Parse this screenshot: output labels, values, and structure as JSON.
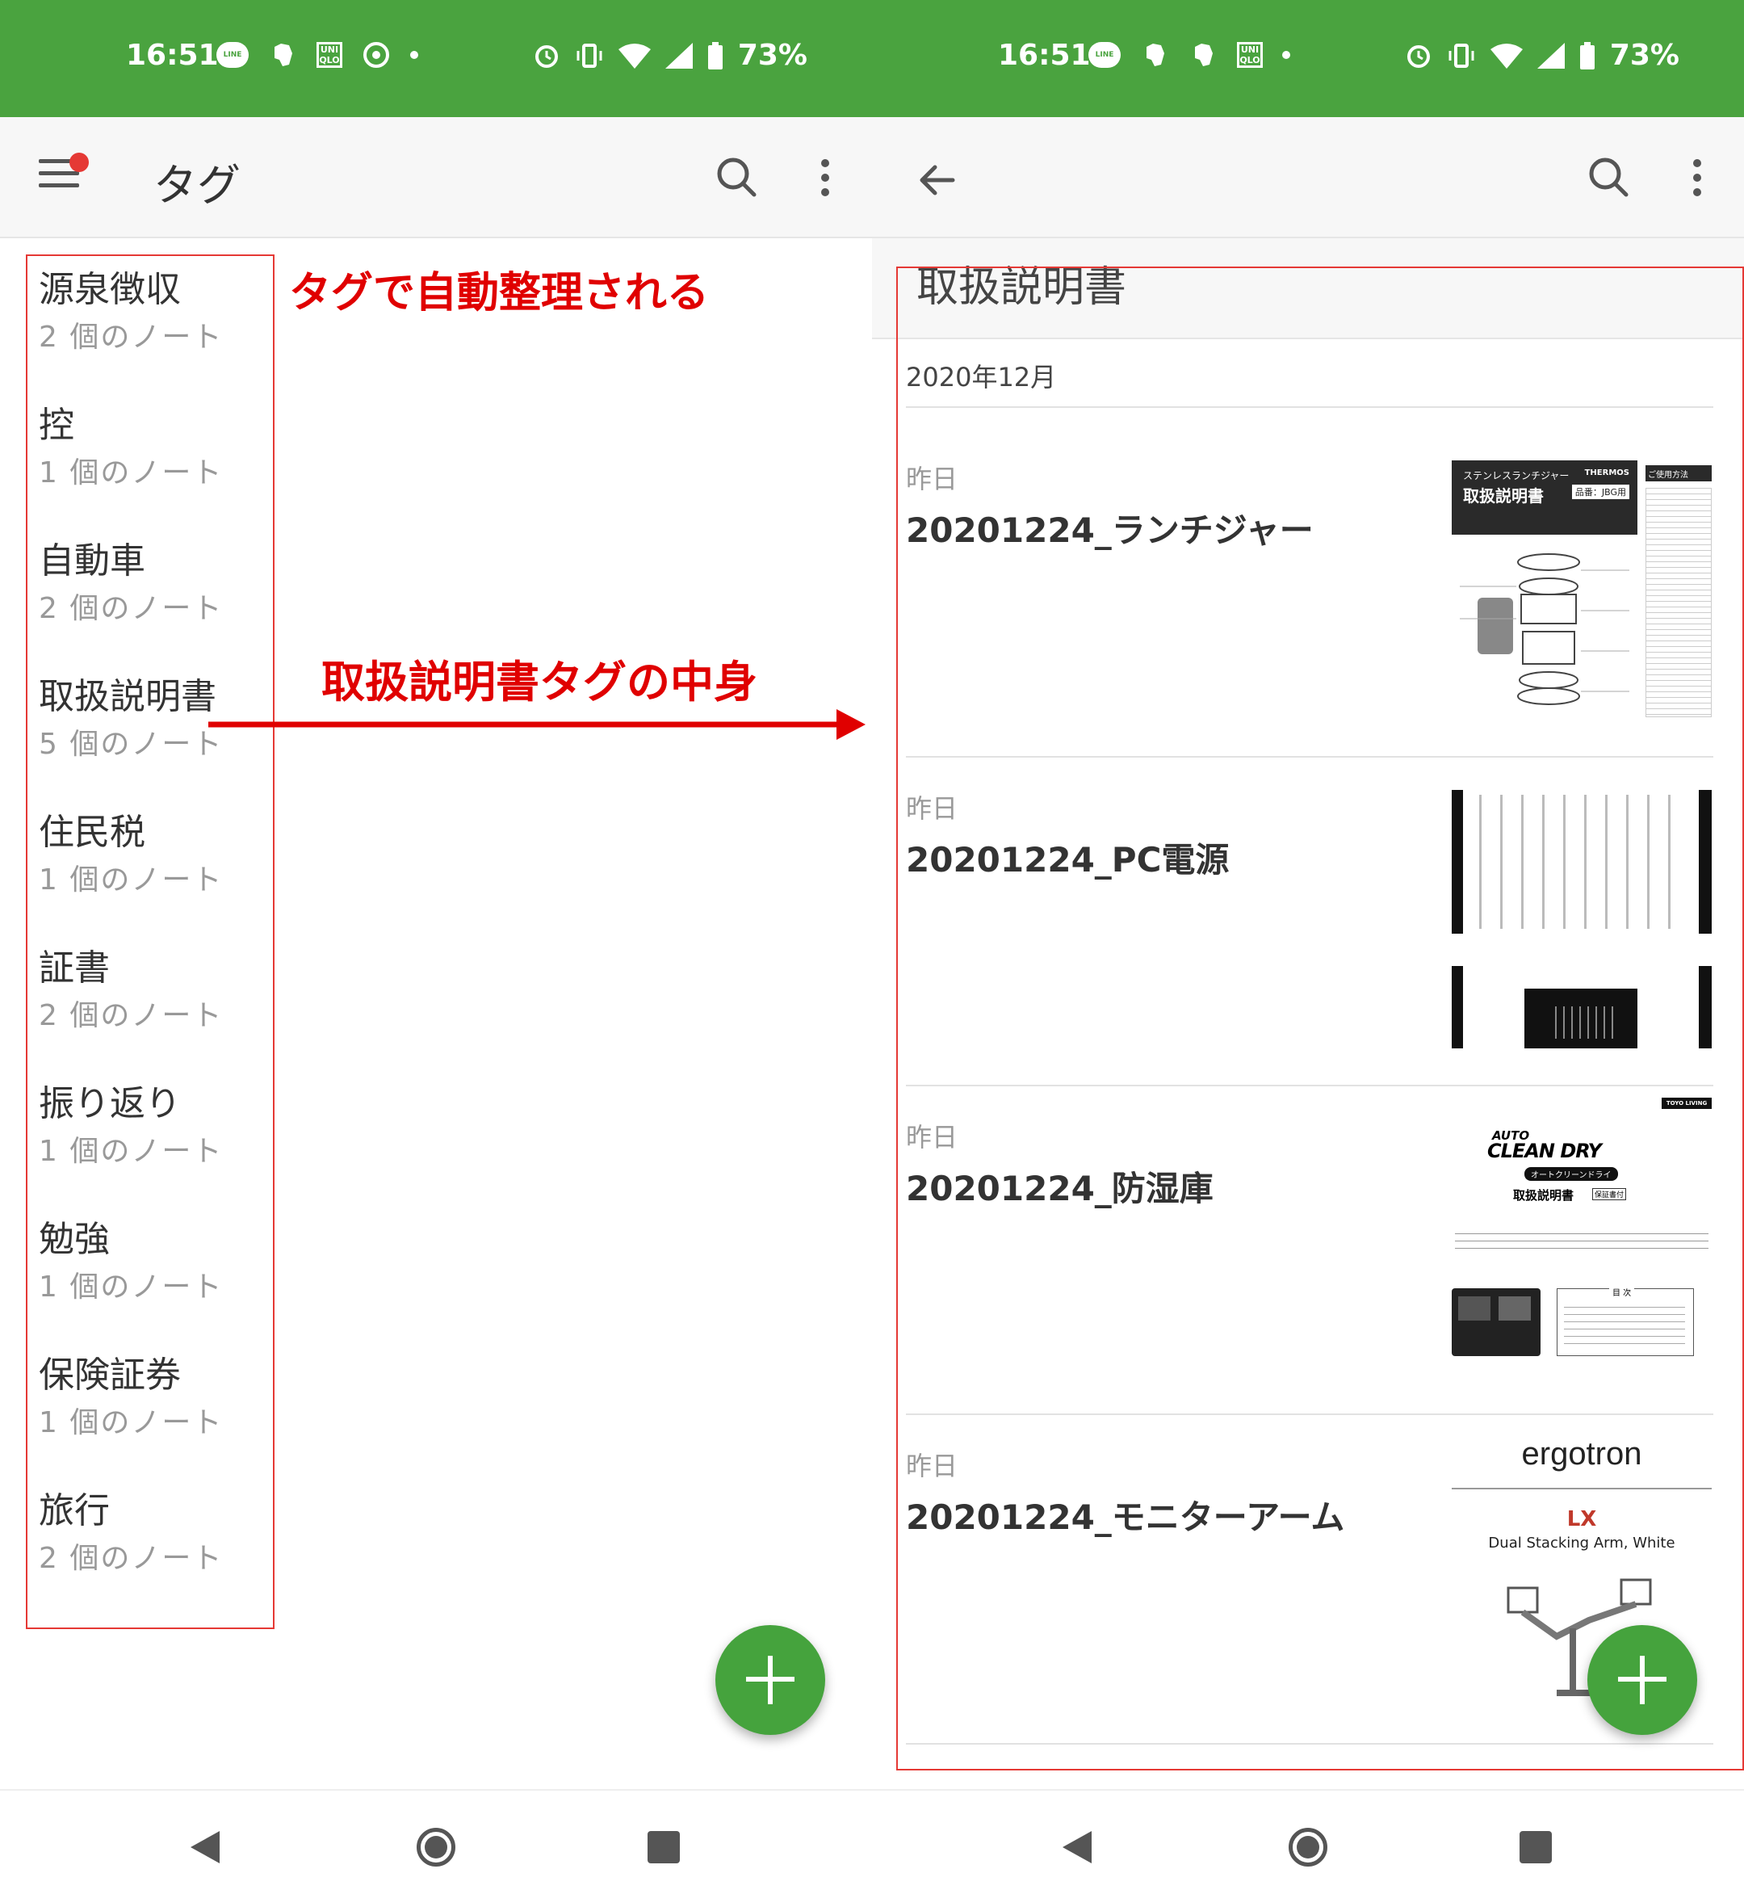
{
  "status_bar": {
    "time": "16:51",
    "battery": "73%"
  },
  "left_screen": {
    "appbar_title": "タグ",
    "tags": [
      {
        "name": "源泉徴収",
        "count": "2 個のノート"
      },
      {
        "name": "控",
        "count": "1 個のノート"
      },
      {
        "name": "自動車",
        "count": "2 個のノート"
      },
      {
        "name": "取扱説明書",
        "count": "5 個のノート"
      },
      {
        "name": "住民税",
        "count": "1 個のノート"
      },
      {
        "name": "証書",
        "count": "2 個のノート"
      },
      {
        "name": "振り返り",
        "count": "1 個のノート"
      },
      {
        "name": "勉強",
        "count": "1 個のノート"
      },
      {
        "name": "保険証券",
        "count": "1 個のノート"
      },
      {
        "name": "旅行",
        "count": "2 個のノート"
      }
    ]
  },
  "annotations": {
    "auto_organize": "タグで自動整理される",
    "tag_contents": "取扱説明書タグの中身"
  },
  "right_screen": {
    "section_title": "取扱説明書",
    "month": "2020年12月",
    "notes": [
      {
        "date": "昨日",
        "title": "20201224_ランチジャー",
        "thumb": {
          "header": "取扱説明書",
          "brand": "THERMOS",
          "model": "品番：JBG用",
          "sub": "ステンレスランチジャー",
          "side": "ご使用方法"
        }
      },
      {
        "date": "昨日",
        "title": "20201224_PC電源"
      },
      {
        "date": "昨日",
        "title": "20201224_防湿庫",
        "thumb": {
          "brand": "TOYO LIVING",
          "logo_top": "AUTO",
          "logo_main": "CLEAN DRY",
          "sub": "オートクリーンドライ",
          "doc": "取扱説明書",
          "warranty": "保証書付",
          "toc": "目 次"
        }
      },
      {
        "date": "昨日",
        "title": "20201224_モニターアーム",
        "thumb": {
          "brand": "ergotron",
          "model": "LX",
          "desc": "Dual Stacking Arm, White"
        }
      }
    ]
  }
}
